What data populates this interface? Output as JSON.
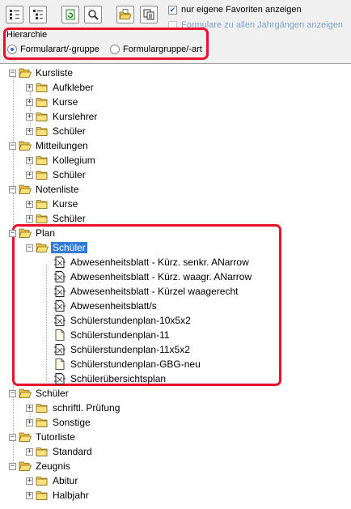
{
  "toolbar": {
    "buttons": [
      "tree-expand-icon",
      "tree-collapse-icon",
      "refresh-icon",
      "search-icon",
      "open-folder-icon",
      "copy-icon"
    ],
    "fav_label": "nur eigene Favoriten anzeigen",
    "fav_checked": true,
    "all_years_label": "Formulare zu allen Jahrgängen anzeigen",
    "all_years_checked": false
  },
  "hierarchy": {
    "title": "Hierarchie",
    "option1": "Formularart/-gruppe",
    "option2": "Formulargruppe/-art",
    "selected": "option1"
  },
  "tree": {
    "kursliste": "Kursliste",
    "aufkleber": "Aufkleber",
    "kurse1": "Kurse",
    "kurslehrer": "Kurslehrer",
    "schueler1": "Schüler",
    "mitteilungen": "Mitteilungen",
    "kollegium": "Kollegium",
    "schueler2": "Schüler",
    "notenliste": "Notenliste",
    "kurse2": "Kurse",
    "schueler3": "Schüler",
    "plan": "Plan",
    "plan_schueler": "Schüler",
    "docs": [
      "Abwesenheitsblatt - Kürz. senkr. ANarrow",
      "Abwesenheitsblatt - Kürz. waagr. ANarrow",
      "Abwesenheitsblatt - Kürzel waagerecht",
      "Abwesenheitsblatt/s",
      "Schülerstundenplan-10x5x2",
      "Schülerstundenplan-11",
      "Schülerstundenplan-11x5x2",
      "Schülerstundenplan-GBG-neu",
      "Schülerübersichtsplan"
    ],
    "schueler4": "Schüler",
    "schriftl": "schriftl. Prüfung",
    "sonstige": "Sonstige",
    "tutorliste": "Tutorliste",
    "standard": "Standard",
    "zeugnis": "Zeugnis",
    "abitur": "Abitur",
    "halbjahr": "Halbjahr"
  }
}
